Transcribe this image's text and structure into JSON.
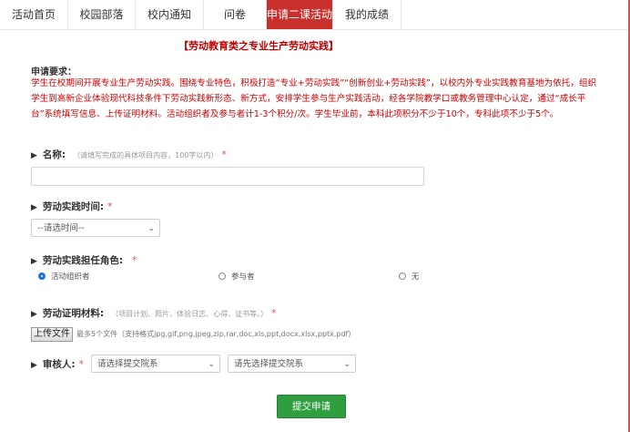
{
  "nav": {
    "tabs": [
      {
        "label": "活动首页"
      },
      {
        "label": "校园部落"
      },
      {
        "label": "校内通知"
      },
      {
        "label": "问卷"
      },
      {
        "label": "申请二课活动积"
      },
      {
        "label": "我的成绩"
      }
    ],
    "active_index": 4
  },
  "colors": {
    "accent_red": "#c9302c",
    "submit_green": "#2f9e3f",
    "radio_blue": "#1a73e8"
  },
  "page": {
    "section_title": "【劳动教育类之专业生产劳动实践】",
    "requirements_label": "申请要求：",
    "requirements_text": "学生在校期间开展专业生产劳动实践。围绕专业特色，积极打造“专业+劳动实践”“创新创业+劳动实践”，以校内外专业实践教育基地为依托，组织学生到高新企业体验现代科技条件下劳动实践新形态、新方式，安排学生参与生产实践活动，经各学院教学口或教务管理中心认定，通过“成长平台”系统填写信息、上传证明材料。活动组织者及参与者计1-3个积分/次。学生毕业前，本科此项积分不少于10个，专科此项不少于5个。"
  },
  "form": {
    "name": {
      "label": "名称:",
      "hint": "（请填写完成的具体项目内容，100字以内）",
      "value": ""
    },
    "time": {
      "label": "劳动实践时间:",
      "select_value": "--请选时间--"
    },
    "role": {
      "label": "劳动实践担任角色:",
      "options": [
        "活动组织者",
        "参与者",
        "无"
      ],
      "selected": "活动组织者"
    },
    "proof": {
      "label": "劳动证明材料:",
      "hint": "（项目计划、照片、体验日志、心得、证书等。）",
      "upload_label": "上传文件",
      "upload_hint": "最多5个文件（支持格式jpg,gif,png,jpeg,zip,rar,doc,xls,ppt,docx,xlsx,pptx,pdf）"
    },
    "reviewer": {
      "label": "审核人:",
      "dept_select": "请选择提交院系",
      "person_select": "请先选择提交院系"
    },
    "required_mark": "*",
    "submit_label": "提交申请"
  }
}
